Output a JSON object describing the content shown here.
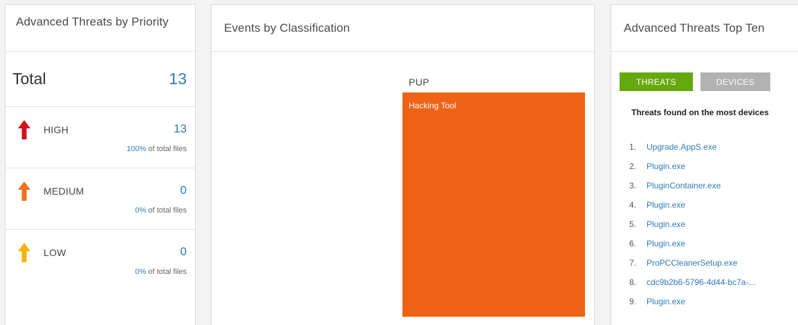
{
  "priority_panel": {
    "title": "Advanced Threats by Priority",
    "total_label": "Total",
    "total_value": "13",
    "pct_suffix": "of total files",
    "rows": [
      {
        "label": "HIGH",
        "count": "13",
        "pct": "100%",
        "color": "#d0121e"
      },
      {
        "label": "MEDIUM",
        "count": "0",
        "pct": "0%",
        "color": "#f07020"
      },
      {
        "label": "LOW",
        "count": "0",
        "pct": "0%",
        "color": "#f4b400"
      }
    ]
  },
  "classification_panel": {
    "title": "Events by Classification",
    "treemap": {
      "group_label": "PUP",
      "tile_label": "Hacking Tool",
      "tile_color": "#ee6315"
    }
  },
  "top_ten_panel": {
    "title": "Advanced Threats Top Ten",
    "tabs": [
      {
        "label": "THREATS",
        "active": true,
        "color": "#67a80e"
      },
      {
        "label": "DEVICES",
        "active": false,
        "color": "#b2b2b2"
      }
    ],
    "list_heading": "Threats found on the most devices",
    "items": [
      {
        "num": "1.",
        "name": "Upgrade.AppS.exe"
      },
      {
        "num": "2.",
        "name": "Plugin.exe"
      },
      {
        "num": "3.",
        "name": "PluginContainer.exe"
      },
      {
        "num": "4.",
        "name": "Plugin.exe"
      },
      {
        "num": "5.",
        "name": "Plugin.exe"
      },
      {
        "num": "6.",
        "name": "Plugin.exe"
      },
      {
        "num": "7.",
        "name": "ProPCCleanerSetup.exe"
      },
      {
        "num": "8.",
        "name": "cdc9b2b6-5796-4d44-bc7a-..."
      },
      {
        "num": "9.",
        "name": "Plugin.exe"
      }
    ]
  }
}
